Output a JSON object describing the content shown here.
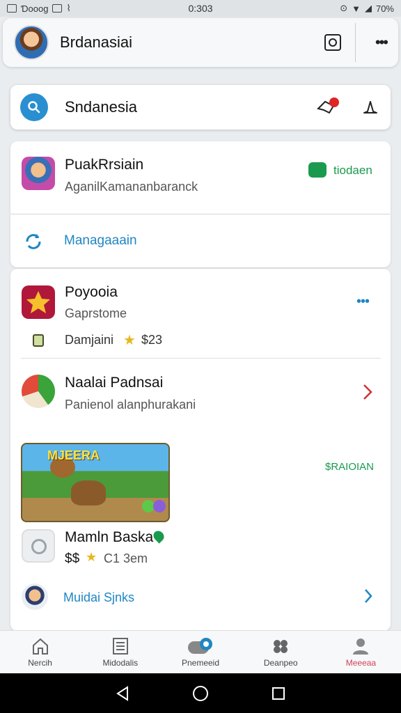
{
  "status_bar": {
    "left_text": "Ɗoooɡ",
    "time": "0:303",
    "battery": "70%"
  },
  "header": {
    "title": "Brdanasiai"
  },
  "search": {
    "value": "Sndanesia"
  },
  "items": [
    {
      "title": "PuakRrsiain",
      "subtitle": "AganilKamananbaranck",
      "status": "tiodaen",
      "status_color": "#1a9a4e"
    }
  ],
  "manage": {
    "label": "Managaaain"
  },
  "game1": {
    "title": "Poyooia",
    "subtitle": "Gaprstome",
    "price_label": "Damjaini",
    "price": "$23"
  },
  "game2": {
    "title": "Naalai Padnsai",
    "subtitle": "Panienol alanphurakani"
  },
  "banner": {
    "title": "MJEERA",
    "tag": "$RAIOIAN",
    "tag_color": "#1a9a4e"
  },
  "game3": {
    "title": "Mamln Baska",
    "price": "$$",
    "meta": "C1 3em"
  },
  "more_link": {
    "label": "Muidai Sjnks"
  },
  "nav": {
    "items": [
      {
        "label": "Nercih",
        "icon": "home-icon"
      },
      {
        "label": "Midodalis",
        "icon": "list-icon"
      },
      {
        "label": "Pnemeeid",
        "icon": "toggle-icon"
      },
      {
        "label": "Deanpeo",
        "icon": "gamepad-icon"
      },
      {
        "label": "Meeeaa",
        "icon": "profile-icon"
      }
    ],
    "active_color": "#d23f5a"
  }
}
